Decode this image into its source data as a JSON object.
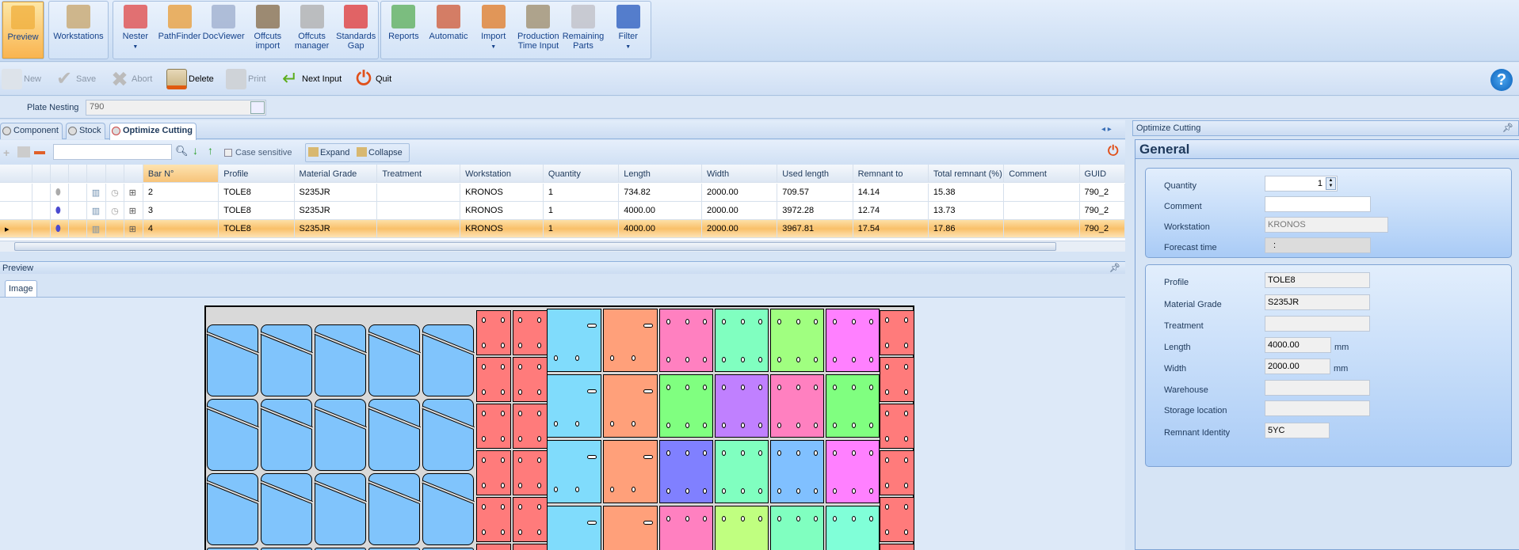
{
  "ribbon": {
    "groups": [
      [
        {
          "label": "Preview",
          "icon": "preview-magnifier-icon",
          "active": true
        }
      ],
      [
        {
          "label": "Workstations",
          "icon": "workstations-w-icon"
        }
      ],
      [
        {
          "label": "Nester",
          "icon": "nester-cubes-icon",
          "dropdown": true
        },
        {
          "label": "PathFinder",
          "icon": "pathfinder-icon"
        },
        {
          "label": "DocViewer",
          "icon": "docviewer-icon"
        },
        {
          "label": "Offcuts import",
          "icon": "offcuts-import-icon"
        },
        {
          "label": "Offcuts manager",
          "icon": "offcuts-manager-icon"
        },
        {
          "label": "Standards Gap",
          "icon": "standards-gap-icon"
        }
      ],
      [
        {
          "label": "Reports",
          "icon": "printer-icon"
        },
        {
          "label": "Automatic",
          "icon": "automatic-gears-icon"
        },
        {
          "label": "Import",
          "icon": "import-icon",
          "dropdown": true
        },
        {
          "label": "Production Time Input",
          "icon": "clock-icon"
        },
        {
          "label": "Remaining Parts",
          "icon": "remaining-parts-icon"
        },
        {
          "label": "Filter",
          "icon": "filter-funnel-icon",
          "dropdown": true
        }
      ]
    ]
  },
  "toolbar": {
    "new": "New",
    "save": "Save",
    "abort": "Abort",
    "delete": "Delete",
    "print": "Print",
    "next_input": "Next Input",
    "quit": "Quit"
  },
  "plate": {
    "label": "Plate Nesting",
    "value": "790"
  },
  "tabs": [
    "Component",
    "Stock",
    "Optimize Cutting"
  ],
  "gridtoolbar": {
    "search_value": "",
    "case_sensitive": "Case sensitive",
    "expand": "Expand",
    "collapse": "Collapse"
  },
  "grid": {
    "columns": [
      "Bar N°",
      "Profile",
      "Material Grade",
      "Treatment",
      "Workstation",
      "Quantity",
      "Length",
      "Width",
      "Used length",
      "Remnant to",
      "Total remnant (%)",
      "Comment",
      "GUID"
    ],
    "rows": [
      [
        "2",
        "TOLE8",
        "S235JR",
        "",
        "KRONOS",
        "1",
        "734.82",
        "2000.00",
        "709.57",
        "14.14",
        "15.38",
        "",
        "790_2"
      ],
      [
        "3",
        "TOLE8",
        "S235JR",
        "",
        "KRONOS",
        "1",
        "4000.00",
        "2000.00",
        "3972.28",
        "12.74",
        "13.73",
        "",
        "790_2"
      ],
      [
        "4",
        "TOLE8",
        "S235JR",
        "",
        "KRONOS",
        "1",
        "4000.00",
        "2000.00",
        "3967.81",
        "17.54",
        "17.86",
        "",
        "790_2"
      ]
    ],
    "selected_row": 2
  },
  "preview": {
    "title": "Preview",
    "tab": "Image",
    "colors": {
      "blue": "#80c4fc",
      "red": "#ff7b7b",
      "cyan": "#80dcfc",
      "orange": "#ffa07a",
      "grid": [
        [
          "#ff80c0",
          "#80ffc0",
          "#a0ff80",
          "#ff80ff"
        ],
        [
          "#80ff80",
          "#c080ff",
          "#ff80c0",
          "#80ff80"
        ],
        [
          "#8080ff",
          "#80ffc0",
          "#80c0ff",
          "#ff80ff"
        ],
        [
          "#ff80c0",
          "#c0ff80",
          "#80ffc0",
          "#80ffd8"
        ],
        [
          "#ff8080",
          "#ffff80",
          "#a080ff",
          "#80c0ff"
        ],
        [
          "#80a8ff",
          "#80dcfc",
          "#a080ff",
          "#80c0ff"
        ],
        [
          "#ff8080",
          "#e0ff80",
          "#ff80a0",
          "#80ffd8"
        ]
      ]
    }
  },
  "panel": {
    "title": "Optimize Cutting",
    "section": "General",
    "quantity_label": "Quantity",
    "quantity": "1",
    "comment_label": "Comment",
    "comment": "",
    "workstation_label": "Workstation",
    "workstation": "KRONOS",
    "forecast_label": "Forecast time",
    "forecast": ":",
    "profile_label": "Profile",
    "profile": "TOLE8",
    "grade_label": "Material Grade",
    "grade": "S235JR",
    "treatment_label": "Treatment",
    "treatment": "",
    "length_label": "Length",
    "length": "4000.00",
    "width_label": "Width",
    "width": "2000.00",
    "unit": "mm",
    "warehouse_label": "Warehouse",
    "warehouse": "",
    "storage_label": "Storage location",
    "storage": "",
    "remnant_label": "Remnant Identity",
    "remnant": "5YC"
  }
}
